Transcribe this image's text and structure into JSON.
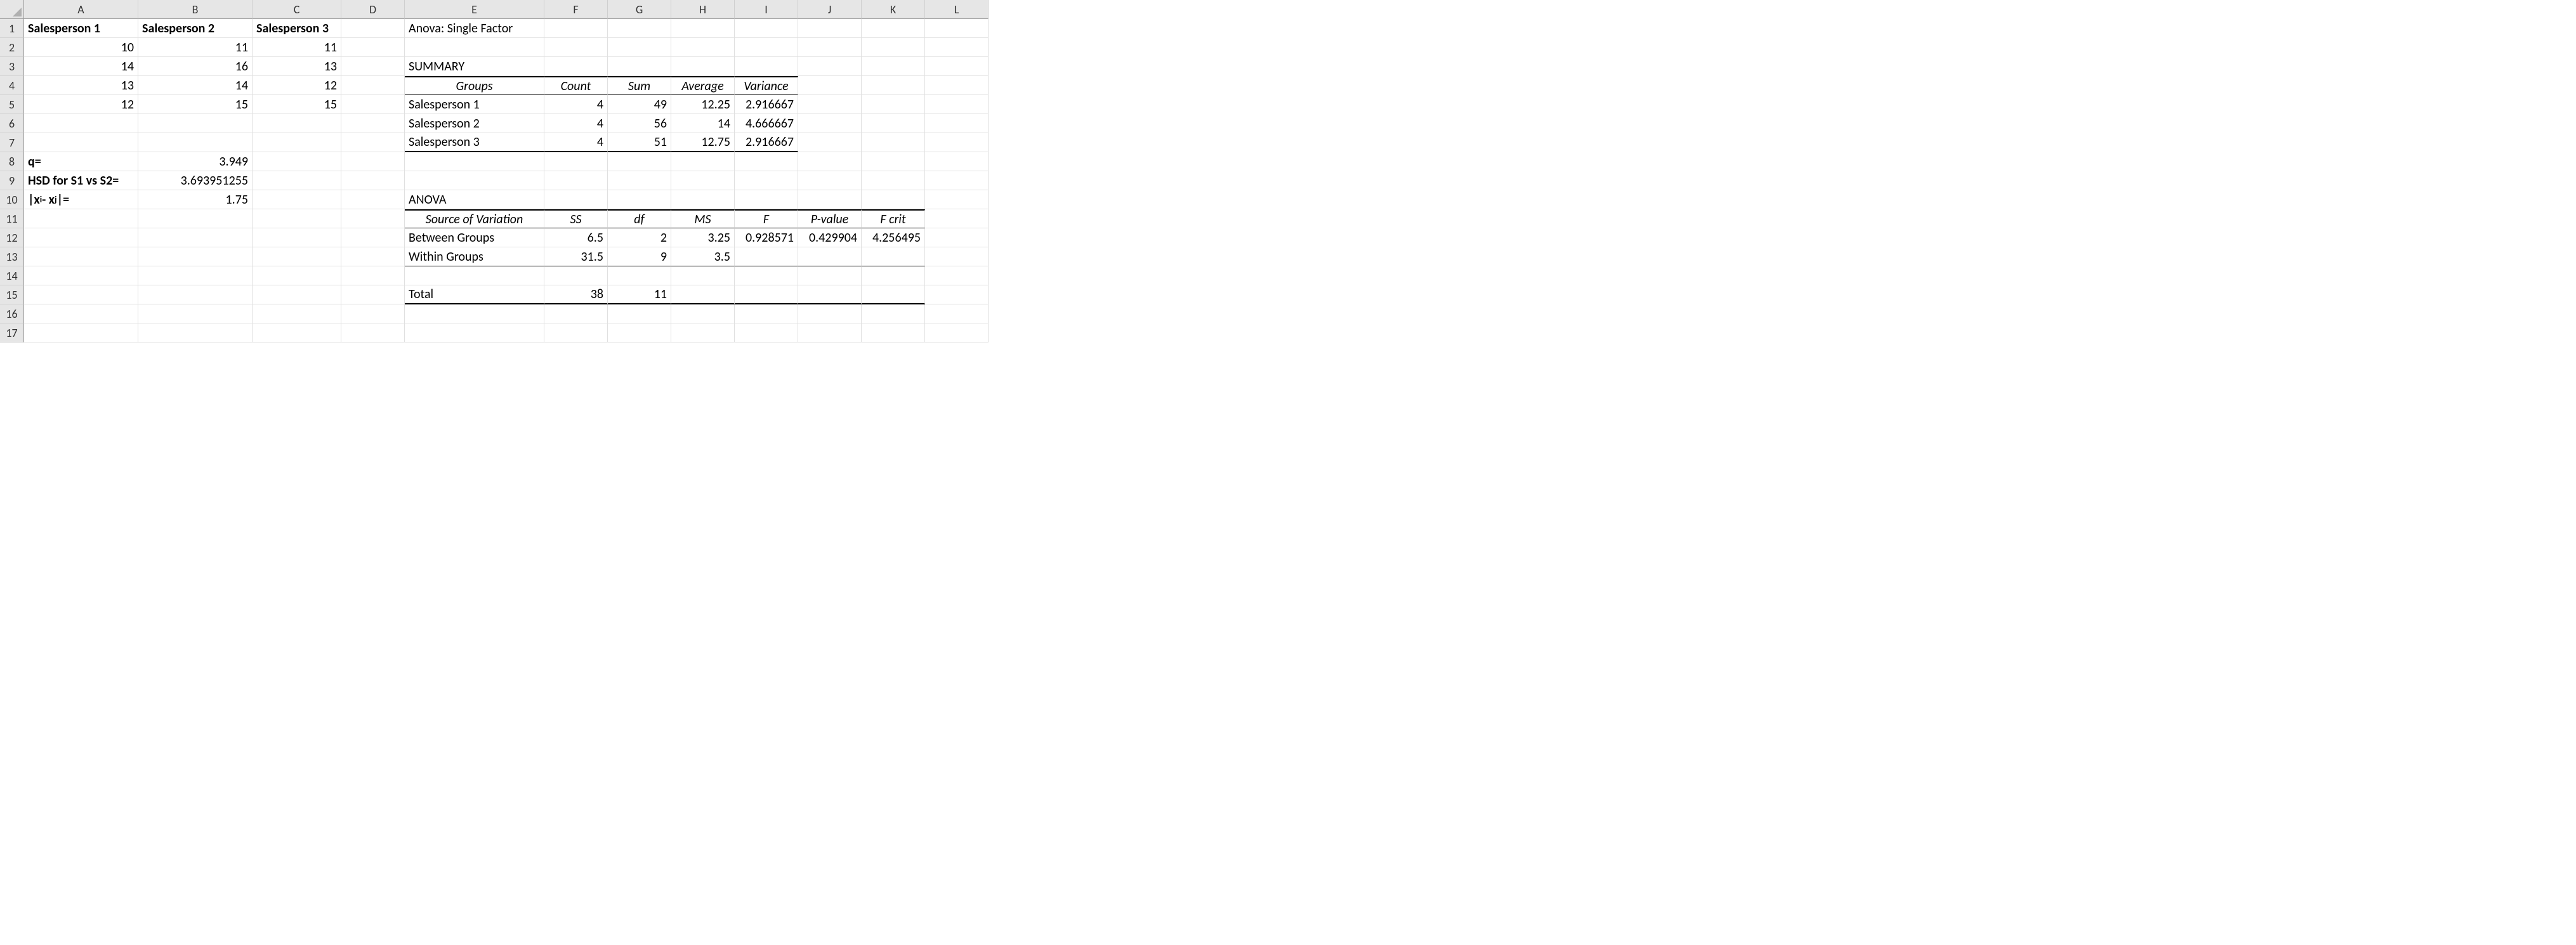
{
  "columns": [
    "A",
    "B",
    "C",
    "D",
    "E",
    "F",
    "G",
    "H",
    "I",
    "J",
    "K",
    "L"
  ],
  "row_count": 17,
  "headers": {
    "s1": "Salesperson 1",
    "s2": "Salesperson 2",
    "s3": "Salesperson 3"
  },
  "data": {
    "s1": [
      10,
      14,
      13,
      12
    ],
    "s2": [
      11,
      16,
      14,
      15
    ],
    "s3": [
      11,
      13,
      12,
      15
    ]
  },
  "calc": {
    "q_label": "q=",
    "q_value": 3.949,
    "hsd_label": "HSD for S1 vs S2=",
    "hsd_value": 3.693951255,
    "absdiff_value": 1.75
  },
  "anova": {
    "title": "Anova: Single Factor",
    "summary_label": "SUMMARY",
    "summary_headers": {
      "groups": "Groups",
      "count": "Count",
      "sum": "Sum",
      "average": "Average",
      "variance": "Variance"
    },
    "summary_rows": [
      {
        "group": "Salesperson 1",
        "count": 4,
        "sum": 49,
        "average": 12.25,
        "variance": 2.916667
      },
      {
        "group": "Salesperson 2",
        "count": 4,
        "sum": 56,
        "average": 14,
        "variance": 4.666667
      },
      {
        "group": "Salesperson 3",
        "count": 4,
        "sum": 51,
        "average": 12.75,
        "variance": 2.916667
      }
    ],
    "anova_label": "ANOVA",
    "anova_headers": {
      "sov": "Source of Variation",
      "ss": "SS",
      "df": "df",
      "ms": "MS",
      "f": "F",
      "pvalue": "P-value",
      "fcrit": "F crit"
    },
    "anova_rows": {
      "between": {
        "label": "Between Groups",
        "ss": 6.5,
        "df": 2,
        "ms": 3.25,
        "f": 0.928571,
        "p": 0.429904,
        "fcrit": 4.256495
      },
      "within": {
        "label": "Within Groups",
        "ss": 31.5,
        "df": 9,
        "ms": 3.5
      },
      "total": {
        "label": "Total",
        "ss": 38,
        "df": 11
      }
    }
  }
}
